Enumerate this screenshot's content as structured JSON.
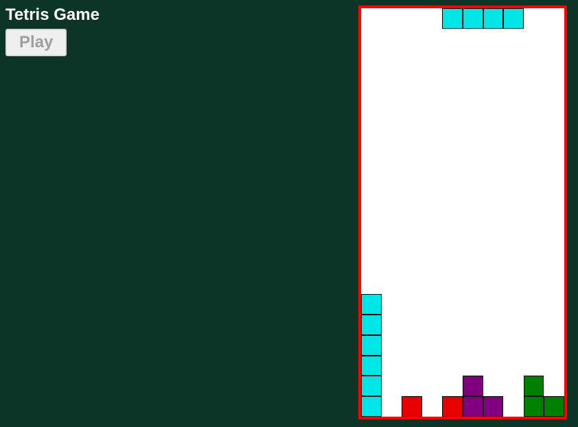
{
  "header": {
    "title": "Tetris Game",
    "play_label": "Play"
  },
  "board": {
    "cols": 10,
    "rows": 20,
    "border_color": "#ff0000",
    "bg_color": "#ffffff"
  },
  "colors": {
    "cyan": "#00e5e5",
    "red": "#e60000",
    "purple": "#800080",
    "green": "#008000"
  },
  "cells": [
    {
      "row": 0,
      "col": 4,
      "color": "cyan"
    },
    {
      "row": 0,
      "col": 5,
      "color": "cyan"
    },
    {
      "row": 0,
      "col": 6,
      "color": "cyan"
    },
    {
      "row": 0,
      "col": 7,
      "color": "cyan"
    },
    {
      "row": 14,
      "col": 0,
      "color": "cyan"
    },
    {
      "row": 15,
      "col": 0,
      "color": "cyan"
    },
    {
      "row": 16,
      "col": 0,
      "color": "cyan"
    },
    {
      "row": 17,
      "col": 0,
      "color": "cyan"
    },
    {
      "row": 18,
      "col": 0,
      "color": "cyan"
    },
    {
      "row": 19,
      "col": 0,
      "color": "cyan"
    },
    {
      "row": 19,
      "col": 2,
      "color": "red"
    },
    {
      "row": 19,
      "col": 4,
      "color": "red"
    },
    {
      "row": 18,
      "col": 5,
      "color": "purple"
    },
    {
      "row": 19,
      "col": 5,
      "color": "purple"
    },
    {
      "row": 19,
      "col": 6,
      "color": "purple"
    },
    {
      "row": 18,
      "col": 8,
      "color": "green"
    },
    {
      "row": 19,
      "col": 8,
      "color": "green"
    },
    {
      "row": 19,
      "col": 9,
      "color": "green"
    }
  ]
}
